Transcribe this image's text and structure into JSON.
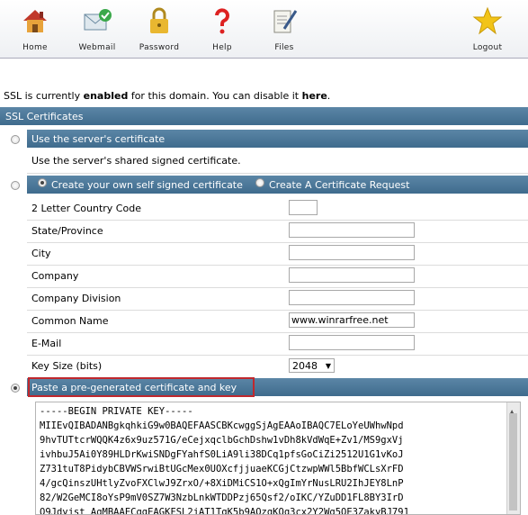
{
  "toolbar": {
    "items": [
      {
        "label": "Home"
      },
      {
        "label": "Webmail"
      },
      {
        "label": "Password"
      },
      {
        "label": "Help"
      },
      {
        "label": "Files"
      },
      {
        "label": "Logout"
      }
    ]
  },
  "status": {
    "prefix": "SSL is currently ",
    "state": "enabled",
    "middle": " for this domain. You can disable it ",
    "link": "here",
    "suffix": "."
  },
  "section_title": "SSL Certificates",
  "option1": {
    "title": "Use the server's certificate",
    "desc": "Use the server's shared signed certificate."
  },
  "option2": {
    "title": "Create your own self signed certificate",
    "alt": "Create A Certificate Request",
    "fields": [
      {
        "label": "2 Letter Country Code",
        "value": ""
      },
      {
        "label": "State/Province",
        "value": ""
      },
      {
        "label": "City",
        "value": ""
      },
      {
        "label": "Company",
        "value": ""
      },
      {
        "label": "Company Division",
        "value": ""
      },
      {
        "label": "Common Name",
        "value": "www.winrarfree.net"
      },
      {
        "label": "E-Mail",
        "value": ""
      }
    ],
    "key_size_label": "Key Size (bits)",
    "key_size_value": "2048"
  },
  "option3": {
    "title": "Paste a pre-generated certificate and key",
    "content": "-----BEGIN PRIVATE KEY-----\nMIIEvQIBADANBgkqhkiG9w0BAQEFAASCBKcwggSjAgEAAoIBAQC7ELoYeUWhwNpd\n9hvTUTtcrWQQK4z6x9uz571G/eCejxqclbGchDshw1vDh8kVdWqE+Zv1/MS9gxVj\nivhbuJ5Ai0Y89HLDrKwiSNDgFYahfS0LiA9li38DCq1pfsGoCiZi2512U1G1vKoJ\nZ731tuT8PidybCBVWSrwiBtUGcMex0UOXcfjjuaeKCGjCtzwpWWl5BbfWCLsXrFD\n4/gcQinszUHtlyZvoFXClwJ9ZrxO/+8XiDMiCS1O+xQgImYrNusLRU2IhJEY8LnP\n82/W2GeMCI8oYsP9mV0SZ7W3NzbLnkWTDDPzj65Qsf2/oIKC/YZuDD1FL8BY3IrD\nO9Jdyjst AgMBAAECggEAGKFSL2jAT1TqK5b9AOzgKQq3cx2Y2Wg5OE3ZakyBJ791"
  }
}
